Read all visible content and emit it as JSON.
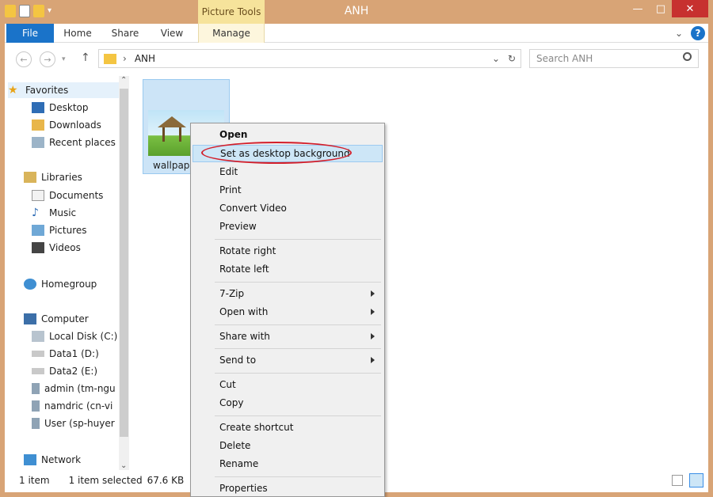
{
  "window": {
    "title": "ANH",
    "context_tab": "Picture Tools",
    "minimize": "—",
    "maximize": "□",
    "close": "✕"
  },
  "ribbon": {
    "tabs": [
      "File",
      "Home",
      "Share",
      "View",
      "Manage"
    ],
    "chevron": "⌄",
    "help": "?"
  },
  "address": {
    "back": "←",
    "forward": "→",
    "up": "↑",
    "path_sep": "›",
    "folder": "ANH",
    "dropdown": "⌄",
    "refresh": "↻"
  },
  "search": {
    "placeholder": "Search ANH",
    "icon": "search-icon"
  },
  "nav": {
    "favorites": {
      "label": "Favorites",
      "items": [
        "Desktop",
        "Downloads",
        "Recent places"
      ]
    },
    "libraries": {
      "label": "Libraries",
      "items": [
        "Documents",
        "Music",
        "Pictures",
        "Videos"
      ]
    },
    "homegroup": "Homegroup",
    "computer": {
      "label": "Computer",
      "items": [
        "Local Disk (C:)",
        "Data1 (D:)",
        "Data2 (E:)",
        "admin (tm-ngu",
        "namdric (cn-vi",
        "User (sp-huyer"
      ]
    },
    "network": "Network",
    "scroll_up": "⌃",
    "scroll_down": "⌄"
  },
  "file": {
    "name": "wallpap"
  },
  "context_menu": {
    "items": [
      {
        "label": "Open"
      },
      {
        "label": "Set as desktop background"
      },
      {
        "label": "Edit"
      },
      {
        "label": "Print"
      },
      {
        "label": "Convert Video"
      },
      {
        "label": "Preview"
      },
      {
        "label": "Rotate right"
      },
      {
        "label": "Rotate left"
      },
      {
        "label": "7-Zip"
      },
      {
        "label": "Open with"
      },
      {
        "label": "Share with"
      },
      {
        "label": "Send to"
      },
      {
        "label": "Cut"
      },
      {
        "label": "Copy"
      },
      {
        "label": "Create shortcut"
      },
      {
        "label": "Delete"
      },
      {
        "label": "Rename"
      },
      {
        "label": "Properties"
      }
    ]
  },
  "status": {
    "count": "1 item",
    "selected": "1 item selected",
    "size": "67.6 KB"
  },
  "colors": {
    "titlebar": "#d8a476",
    "file_tab": "#1a73c9",
    "close_button": "#c7312f",
    "highlight": "#cde6f7",
    "annotation": "#d31e2a"
  }
}
